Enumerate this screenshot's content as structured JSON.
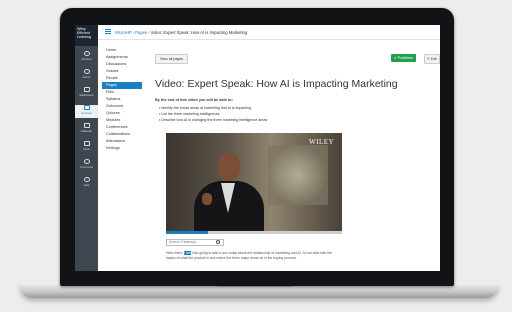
{
  "logo": {
    "line1": "Wiley",
    "line2": "Efficient",
    "line3": "Learning"
  },
  "global_nav": [
    {
      "id": "account",
      "label": "Account",
      "icon": "account-icon"
    },
    {
      "id": "admin",
      "label": "Admin",
      "icon": "admin-icon"
    },
    {
      "id": "dashboard",
      "label": "Dashboard",
      "icon": "dashboard-icon"
    },
    {
      "id": "courses",
      "label": "Courses",
      "icon": "courses-icon",
      "active": true
    },
    {
      "id": "calendar",
      "label": "Calendar",
      "icon": "calendar-icon"
    },
    {
      "id": "inbox",
      "label": "Inbox",
      "icon": "inbox-icon"
    },
    {
      "id": "commons",
      "label": "Commons",
      "icon": "commons-icon"
    },
    {
      "id": "help",
      "label": "Help",
      "icon": "help-icon"
    }
  ],
  "breadcrumb": {
    "course": "WUAIHP",
    "section": "Pages",
    "current": "Video: Expert Speak: How AI is Impacting Marketing"
  },
  "course_nav": [
    "Home",
    "Assignments",
    "Discussions",
    "Grades",
    "People",
    "Pages",
    "Files",
    "Syllabus",
    "Outcomes",
    "Quizzes",
    "Modules",
    "Conferences",
    "Collaborations",
    "Attendance",
    "Settings"
  ],
  "active_course_nav": "Pages",
  "buttons": {
    "view_all": "View all pages",
    "published": "Published",
    "edit": "✎ Edit"
  },
  "page": {
    "title": "Video: Expert Speak: How AI is Impacting Marketing",
    "intro": "By the end of this video you will be able to:",
    "bullets": [
      "Identify the broad areas of marketing that AI is impacting",
      "List the three marketing intelligences",
      "Describe how AI is changing the three marketing intelligence areas"
    ]
  },
  "video": {
    "watermark": "WILEY",
    "progress": 0.24
  },
  "search": {
    "placeholder": "Search Transcript..."
  },
  "transcript": {
    "speaker": "Hello there,",
    "highlight": "I am",
    "rest": "Vish going to talk to you today about the relationship of marketing and AI. So we start with the basics of what the product is and where the three major areas sit in the buying process."
  },
  "colors": {
    "accent": "#1a7fc1",
    "published": "#22a050",
    "global_nav_bg": "#3e4750"
  }
}
